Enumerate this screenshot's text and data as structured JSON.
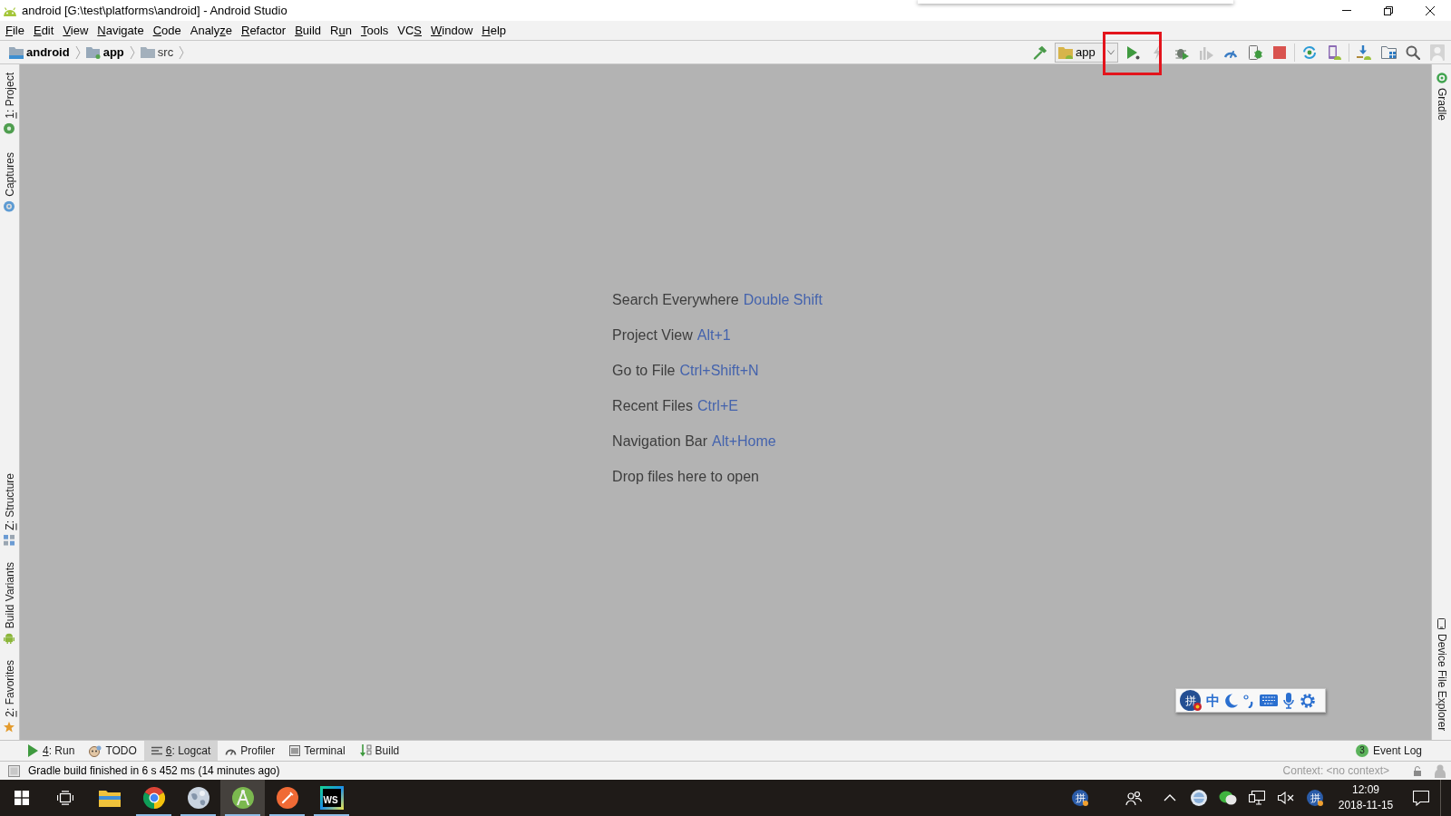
{
  "window": {
    "title": "android [G:\\test\\platforms\\android] - Android Studio"
  },
  "menu": [
    {
      "key": "F",
      "post": "ile"
    },
    {
      "key": "E",
      "post": "dit"
    },
    {
      "key": "V",
      "post": "iew"
    },
    {
      "key": "N",
      "post": "avigate"
    },
    {
      "key": "C",
      "post": "ode"
    },
    {
      "pre": "Analy",
      "key": "z",
      "post": "e"
    },
    {
      "key": "R",
      "post": "efactor"
    },
    {
      "key": "B",
      "post": "uild"
    },
    {
      "pre": "R",
      "key": "u",
      "post": "n"
    },
    {
      "key": "T",
      "post": "ools"
    },
    {
      "pre": "VC",
      "key": "S"
    },
    {
      "key": "W",
      "post": "indow"
    },
    {
      "key": "H",
      "post": "elp"
    }
  ],
  "breadcrumbs": [
    {
      "label": "android",
      "kind": "project"
    },
    {
      "label": "app",
      "kind": "module"
    },
    {
      "label": "src",
      "kind": "folder"
    }
  ],
  "toolbar": {
    "run_config": {
      "label": "app"
    },
    "groups": [
      [
        {
          "kind": "build",
          "disabled": false,
          "highlighted": false
        }
      ],
      [
        {
          "kind": "run",
          "disabled": false,
          "highlighted": true
        },
        {
          "kind": "apply-changes",
          "disabled": true,
          "highlighted": false
        },
        {
          "kind": "debug",
          "disabled": false,
          "highlighted": false
        },
        {
          "kind": "coverage",
          "disabled": true,
          "highlighted": false
        },
        {
          "kind": "profile",
          "disabled": false,
          "highlighted": false
        },
        {
          "kind": "attach-debugger",
          "disabled": false,
          "highlighted": false
        },
        {
          "kind": "stop",
          "disabled": false,
          "highlighted": false
        }
      ],
      [
        {
          "kind": "sync",
          "disabled": false,
          "highlighted": false
        },
        {
          "kind": "avd-manager",
          "disabled": false,
          "highlighted": false
        }
      ],
      [
        {
          "kind": "sdk-manager",
          "disabled": false,
          "highlighted": false
        },
        {
          "kind": "project-structure",
          "disabled": false,
          "highlighted": false
        },
        {
          "kind": "search",
          "disabled": false,
          "highlighted": false
        },
        {
          "kind": "account",
          "disabled": false,
          "highlighted": false
        }
      ]
    ]
  },
  "left_tool_windows": {
    "top": [
      {
        "kind": "project",
        "key": "1",
        "post": ": Project",
        "selected": false
      },
      {
        "kind": "captures",
        "label": "Captures",
        "selected": false
      }
    ],
    "bottom": [
      {
        "kind": "structure",
        "key": "Z",
        "post": ": Structure",
        "selected": false
      },
      {
        "kind": "build-variants",
        "label": "Build Variants",
        "selected": false
      },
      {
        "kind": "favorites",
        "key": "2",
        "post": ": Favorites",
        "selected": false
      }
    ]
  },
  "right_tool_windows": {
    "top": [
      {
        "kind": "gradle",
        "label": "Gradle",
        "selected": false
      }
    ],
    "bottom": [
      {
        "kind": "device-file-explorer",
        "label": "Device File Explorer",
        "selected": false
      }
    ]
  },
  "editor_hints": [
    {
      "text": "Search Everywhere",
      "shortcut": "Double Shift"
    },
    {
      "text": "Project View",
      "shortcut": "Alt+1"
    },
    {
      "text": "Go to File",
      "shortcut": "Ctrl+Shift+N"
    },
    {
      "text": "Recent Files",
      "shortcut": "Ctrl+E"
    },
    {
      "text": "Navigation Bar",
      "shortcut": "Alt+Home"
    },
    {
      "text": "Drop files here to open"
    }
  ],
  "ime_toolbar": {
    "logo": "拼",
    "mode": "中"
  },
  "bottom_tool_windows": {
    "tabs": [
      {
        "kind": "run",
        "key": "4",
        "post": ": Run",
        "selected": false
      },
      {
        "kind": "todo",
        "label": "TODO",
        "selected": false
      },
      {
        "kind": "logcat",
        "key": "6",
        "post": ": Logcat",
        "selected": true
      },
      {
        "kind": "profiler",
        "label": "Profiler",
        "selected": false
      },
      {
        "kind": "terminal",
        "label": "Terminal",
        "selected": false
      },
      {
        "kind": "build",
        "label": "Build",
        "selected": false
      }
    ],
    "event_log": {
      "count": "3",
      "label": "Event Log"
    }
  },
  "status_bar": {
    "message": "Gradle build finished in 6 s 452 ms (14 minutes ago)",
    "context": "Context: <no context>"
  },
  "taskbar": {
    "apps": [
      {
        "kind": "file-explorer",
        "running": false,
        "selected": false
      },
      {
        "kind": "browser",
        "running": true,
        "selected": false
      },
      {
        "kind": "globe",
        "running": true,
        "selected": false
      },
      {
        "kind": "studio",
        "running": true,
        "selected": true
      },
      {
        "kind": "pen",
        "running": true,
        "selected": false
      },
      {
        "kind": "ide",
        "text": "WS",
        "running": true,
        "selected": false
      }
    ],
    "tray": [
      {
        "kind": "ime",
        "text": "拼"
      },
      {
        "kind": "people"
      },
      {
        "kind": "chevron"
      },
      {
        "kind": "globe"
      },
      {
        "kind": "chat"
      },
      {
        "kind": "network"
      },
      {
        "kind": "volume-muted"
      },
      {
        "kind": "ime",
        "text": "拼"
      }
    ],
    "clock": {
      "time": "12:09",
      "date": "2018-11-15"
    }
  }
}
